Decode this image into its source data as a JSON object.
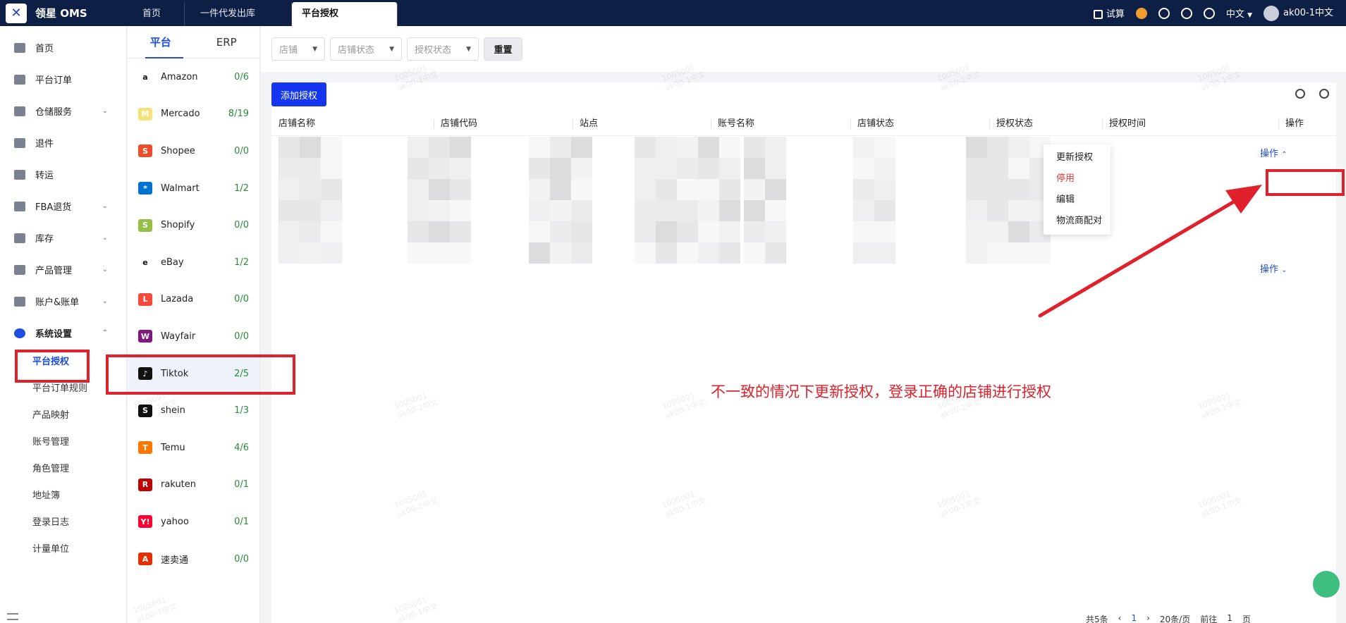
{
  "app": {
    "title": "领星 OMS"
  },
  "topbar": {
    "tabs": [
      {
        "label": "首页"
      },
      {
        "label": "一件代发出库"
      },
      {
        "label": "平台授权"
      }
    ],
    "trial_label": "试算",
    "language": "中文",
    "username": "ak00-1中文"
  },
  "sidenav": {
    "items": [
      {
        "label": "首页",
        "icon": "home-icon"
      },
      {
        "label": "平台订单",
        "icon": "clipboard-icon"
      },
      {
        "label": "仓储服务",
        "icon": "warehouse-icon"
      },
      {
        "label": "退件",
        "icon": "return-icon"
      },
      {
        "label": "转运",
        "icon": "transfer-icon"
      },
      {
        "label": "FBA退货",
        "icon": "fba-icon"
      },
      {
        "label": "库存",
        "icon": "inventory-icon"
      },
      {
        "label": "产品管理",
        "icon": "product-icon"
      },
      {
        "label": "账户&账单",
        "icon": "account-icon"
      },
      {
        "label": "系统设置",
        "icon": "settings-icon"
      }
    ],
    "sub_items": [
      {
        "label": "平台授权"
      },
      {
        "label": "平台订单规则"
      },
      {
        "label": "产品映射"
      },
      {
        "label": "账号管理"
      },
      {
        "label": "角色管理"
      },
      {
        "label": "地址簿"
      },
      {
        "label": "登录日志"
      },
      {
        "label": "计量单位"
      }
    ]
  },
  "platforms": {
    "tabs": [
      {
        "label": "平台"
      },
      {
        "label": "ERP"
      }
    ],
    "items": [
      {
        "name": "Amazon",
        "count": "0/6",
        "logo": "a",
        "color": "#ffffff"
      },
      {
        "name": "Mercado",
        "count": "8/19",
        "logo": "M",
        "color": "#f6e27a"
      },
      {
        "name": "Shopee",
        "count": "0/0",
        "logo": "S",
        "color": "#ee4d2d"
      },
      {
        "name": "Walmart",
        "count": "1/2",
        "logo": "*",
        "color": "#0071ce"
      },
      {
        "name": "Shopify",
        "count": "0/0",
        "logo": "S",
        "color": "#95bf47"
      },
      {
        "name": "eBay",
        "count": "1/2",
        "logo": "e",
        "color": "#ffffff"
      },
      {
        "name": "Lazada",
        "count": "0/0",
        "logo": "L",
        "color": "#f5493b"
      },
      {
        "name": "Wayfair",
        "count": "0/0",
        "logo": "W",
        "color": "#7f187f"
      },
      {
        "name": "Tiktok",
        "count": "2/5",
        "logo": "♪",
        "color": "#111111"
      },
      {
        "name": "shein",
        "count": "1/3",
        "logo": "S",
        "color": "#111111"
      },
      {
        "name": "Temu",
        "count": "4/6",
        "logo": "T",
        "color": "#fb7701"
      },
      {
        "name": "rakuten",
        "count": "0/1",
        "logo": "R",
        "color": "#bf0000"
      },
      {
        "name": "yahoo",
        "count": "0/1",
        "logo": "Y!",
        "color": "#ff0033"
      },
      {
        "name": "速卖通",
        "count": "0/0",
        "logo": "A",
        "color": "#e62e04"
      }
    ]
  },
  "filters": {
    "shop_placeholder": "店铺",
    "shop_status_placeholder": "店铺状态",
    "auth_status_placeholder": "授权状态",
    "reset_label": "重置"
  },
  "toolbar": {
    "add_label": "添加授权"
  },
  "table": {
    "columns": [
      "店铺名称",
      "店铺代码",
      "站点",
      "账号名称",
      "店铺状态",
      "授权状态",
      "授权时间",
      "操作"
    ],
    "op_label": "操作"
  },
  "dropdown": {
    "items": [
      "更新授权",
      "停用",
      "编辑",
      "物流商配对"
    ]
  },
  "annotation": {
    "text": "不一致的情况下更新授权，登录正确的店铺进行授权"
  },
  "watermark": {
    "line1": "1005001",
    "line2": "ak00-1中文"
  },
  "pager": {
    "total": "共5条",
    "page": "1",
    "page_size": "20条/页",
    "goto": "前往",
    "goto_page": "1",
    "page_unit": "页"
  }
}
